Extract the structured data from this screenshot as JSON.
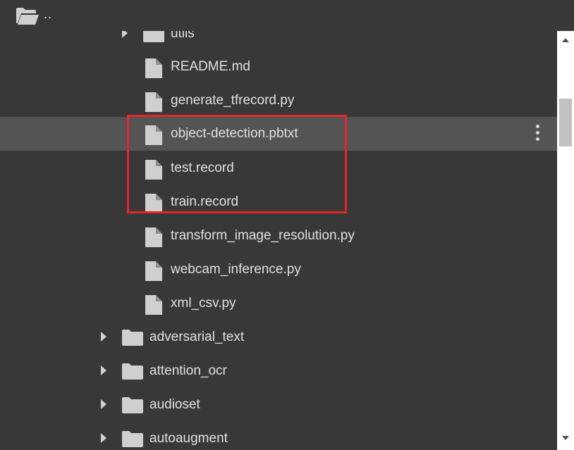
{
  "topbar": {
    "up_label": "..",
    "up_icon": "folder-open-icon"
  },
  "tree": {
    "items": [
      {
        "label": "utils",
        "kind": "folder",
        "expanded": false,
        "depth": 2
      },
      {
        "label": "README.md",
        "kind": "file",
        "depth": 3
      },
      {
        "label": "generate_tfrecord.py",
        "kind": "file",
        "depth": 3
      },
      {
        "label": "object-detection.pbtxt",
        "kind": "file",
        "depth": 3,
        "selected": true
      },
      {
        "label": "test.record",
        "kind": "file",
        "depth": 3
      },
      {
        "label": "train.record",
        "kind": "file",
        "depth": 3
      },
      {
        "label": "transform_image_resolution.py",
        "kind": "file",
        "depth": 3
      },
      {
        "label": "webcam_inference.py",
        "kind": "file",
        "depth": 3
      },
      {
        "label": "xml_csv.py",
        "kind": "file",
        "depth": 3
      },
      {
        "label": "adversarial_text",
        "kind": "folder",
        "expanded": false,
        "depth": 1
      },
      {
        "label": "attention_ocr",
        "kind": "folder",
        "expanded": false,
        "depth": 1
      },
      {
        "label": "audioset",
        "kind": "folder",
        "expanded": false,
        "depth": 1
      },
      {
        "label": "autoaugment",
        "kind": "folder",
        "expanded": false,
        "depth": 1
      }
    ]
  },
  "annotation": {
    "highlight_color": "#e8252b"
  },
  "colors": {
    "background": "#383838",
    "selected_row": "#545454",
    "text": "#e0e0e0",
    "icon": "#cfcfcf"
  }
}
